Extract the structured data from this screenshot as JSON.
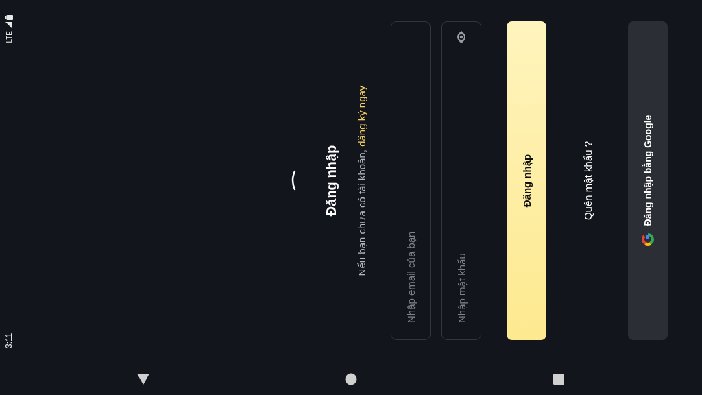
{
  "status_bar": {
    "time": "3:11",
    "network": "LTE"
  },
  "title": "Đăng nhập",
  "subtitle": {
    "text": "Nếu bạn chưa có tài khoản,",
    "link": "đăng ký ngay"
  },
  "email_field": {
    "placeholder": "Nhập email của bạn"
  },
  "password_field": {
    "placeholder": "Nhập mật khẩu"
  },
  "login_button": "Đăng nhập",
  "forgot_password": "Quên mật khẩu ?",
  "google_button": "Đăng nhập bằng Google"
}
